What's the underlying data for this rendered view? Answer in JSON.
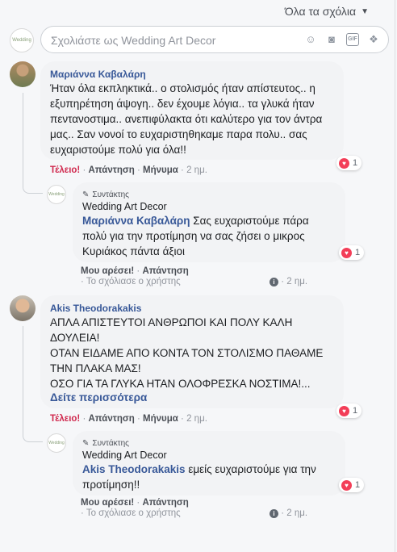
{
  "sort": {
    "label": "Όλα τα σχόλια"
  },
  "compose": {
    "placeholder": "Σχολιάστε ως Wedding Art Decor",
    "avatar_text": "Wedding",
    "icons": [
      "smiley-icon",
      "camera-icon",
      "gif-icon",
      "sticker-icon"
    ]
  },
  "comments": [
    {
      "author": "Μαριάννα Καβαλάρη",
      "text": "Ήταν όλα εκπληκτικά.. ο στολισμός ήταν απίστευτος.. η εξυπηρέτηση άψογη.. δεν έχουμε λόγια.. τα γλυκά ήταν πεντανοστιμα.. ανεπιφύλακτα ότι καλύτερο για τον άντρα μας.. Σαν νονοί το ευχαριστηθηκαμε παρα πολυ.. σας ευχαριστούμε πολύ για όλα!!",
      "actions": {
        "reaction": "Τέλειο!",
        "reply": "Απάντηση",
        "message": "Μήνυμα",
        "time": "2 ημ."
      },
      "reactions": "1",
      "reply": {
        "badge": "Συντάκτης",
        "page": "Wedding Art Decor",
        "tag": "Μαριάννα Καβαλάρη",
        "text": " Σας ευχαριστούμε πάρα πολύ για την προτίμηση να σας ζήσει ο μικρος Κυριάκος πάντα άξιοι",
        "like": "Μου αρέσει!",
        "reply": "Απάντηση",
        "seen": "Το σχόλιασε ο χρήστης",
        "time": "2 ημ.",
        "reactions": "1"
      }
    },
    {
      "author": "Akis Theodorakakis",
      "text": "ΑΠΛΑ ΑΠΙΣΤΕΥΤΟΙ ΑΝΘΡΩΠΟΙ ΚΑΙ ΠΟΛΥ ΚΑΛΗ ΔΟΥΛΕΙΑ!\nΟΤΑΝ ΕΙΔΑΜΕ ΑΠΟ ΚΟΝΤΑ ΤΟΝ ΣΤΟΛΙΣΜΟ ΠΑΘΑΜΕ ΤΗΝ ΠΛΑΚΑ ΜΑΣ!\nΟΣΟ ΓΙΑ ΤΑ ΓΛΥΚΑ ΗΤΑΝ ΟΛΟΦΡΕΣΚΑ ΝΟΣΤΙΜΑ!...",
      "see_more": "Δείτε περισσότερα",
      "actions": {
        "reaction": "Τέλειο!",
        "reply": "Απάντηση",
        "message": "Μήνυμα",
        "time": "2 ημ."
      },
      "reactions": "1",
      "reply": {
        "badge": "Συντάκτης",
        "page": "Wedding Art Decor",
        "tag": "Akis Theodorakakis",
        "text": " εμείς ευχαριστούμε για την προτίμηση!!",
        "like": "Μου αρέσει!",
        "reply": "Απάντηση",
        "seen": "Το σχόλιασε ο χρήστης",
        "time": "2 ημ.",
        "reactions": "1"
      }
    }
  ],
  "colors": {
    "link": "#385898",
    "love": "#d0294e",
    "heart": "#f33e58",
    "bubble": "#f2f3f5"
  }
}
